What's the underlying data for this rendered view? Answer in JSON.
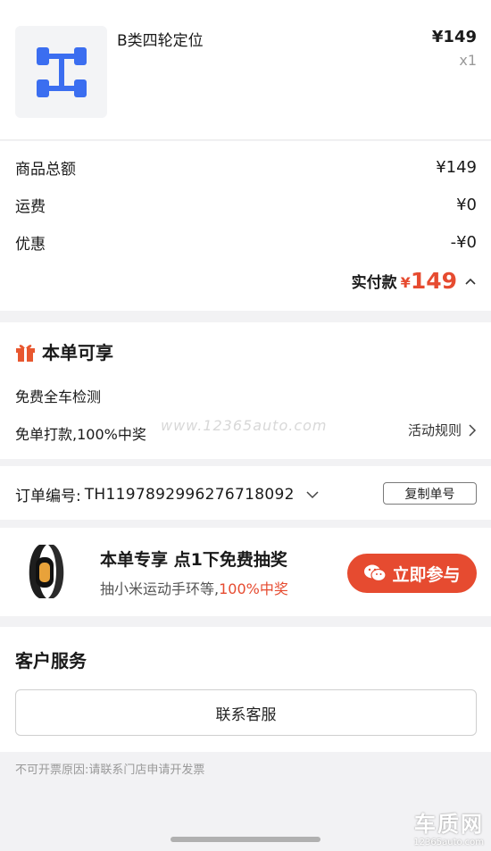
{
  "product": {
    "name": "B类四轮定位",
    "price": "¥149",
    "qty": "x1",
    "icon": "wheel-alignment-icon"
  },
  "summary": {
    "rows": [
      {
        "label": "商品总额",
        "value": "¥149"
      },
      {
        "label": "运费",
        "value": "¥0"
      },
      {
        "label": "优惠",
        "value": "-¥0"
      }
    ],
    "paid_label": "实付款",
    "paid_currency": "¥",
    "paid_amount": "149"
  },
  "benefit": {
    "title": "本单可享",
    "items": [
      "免费全车检测",
      "免单打款,100%中奖"
    ],
    "rules_label": "活动规则",
    "watermark": "www.12365auto.com"
  },
  "order": {
    "label": "订单编号:",
    "number": "TH1197892996276718092",
    "copy_label": "复制单号"
  },
  "promo": {
    "title": "本单专享 点1下免费抽奖",
    "sub_prefix": "抽小米运动手环等,",
    "sub_highlight": "100%中奖",
    "button_label": "立即参与"
  },
  "service": {
    "title": "客户服务",
    "contact_label": "联系客服"
  },
  "invoice_note": "不可开票原因:请联系门店申请开发票",
  "site_logo": {
    "big": "车质网",
    "small": "12365auto.com"
  },
  "colors": {
    "accent": "#e64b30",
    "icon_blue": "#3b6ef0",
    "gift": "#e8572f"
  }
}
